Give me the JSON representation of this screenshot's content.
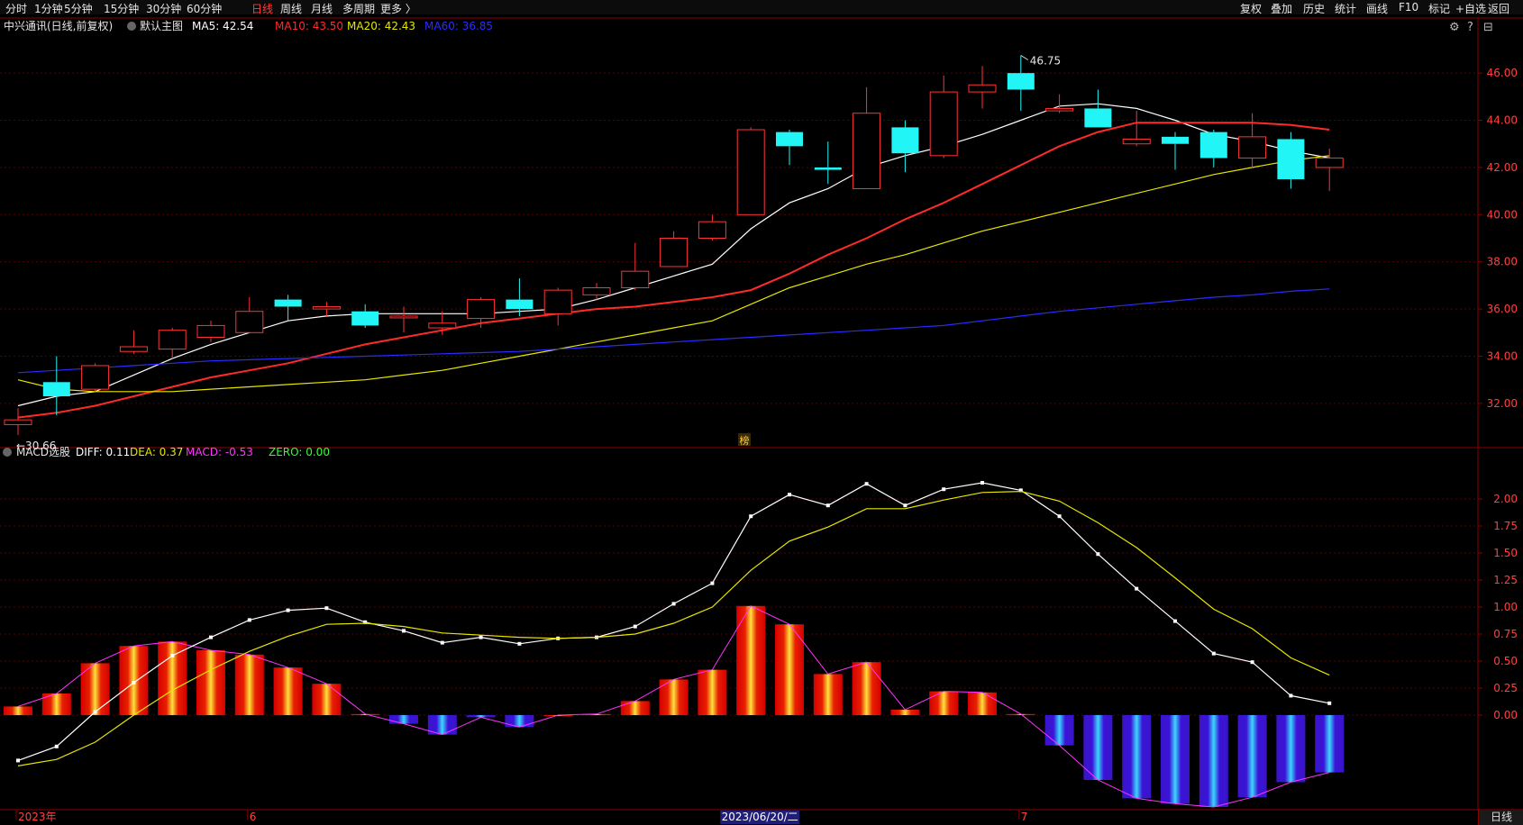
{
  "toolbar": {
    "left_items": [
      {
        "label": "分时",
        "active": false
      },
      {
        "label": "1分钟",
        "active": false
      },
      {
        "label": "5分钟",
        "active": false
      },
      {
        "label": "15分钟",
        "active": false
      },
      {
        "label": "30分钟",
        "active": false
      },
      {
        "label": "60分钟",
        "active": false
      },
      {
        "label": "日线",
        "active": true
      },
      {
        "label": "周线",
        "active": false
      },
      {
        "label": "月线",
        "active": false
      },
      {
        "label": "多周期",
        "active": false
      },
      {
        "label": "更多 〉",
        "active": false
      }
    ],
    "right_items": [
      "复权",
      "叠加",
      "历史",
      "统计",
      "画线",
      "F10",
      "标记",
      "+自选",
      "返回"
    ]
  },
  "main_panel": {
    "title": "中兴通讯(日线,前复权)",
    "indicator_name": "默认主图",
    "legend": [
      {
        "text": "MA5: 42.54",
        "color": "#ffffff"
      },
      {
        "text": "MA10: 43.50",
        "color": "#ff2a2a"
      },
      {
        "text": "MA20: 42.43",
        "color": "#e6e600"
      },
      {
        "text": "MA60: 36.85",
        "color": "#2b2bff"
      }
    ],
    "high_label": "46.75",
    "low_label": "←30.66",
    "marker_label": "榜",
    "panel_icons": [
      "⚙",
      "?",
      "⊟"
    ]
  },
  "macd_panel": {
    "title": "MACD选股",
    "legend": [
      {
        "text": "DIFF: 0.11",
        "color": "#ffffff"
      },
      {
        "text": "DEA: 0.37",
        "color": "#e6e600"
      },
      {
        "text": "MACD: -0.53",
        "color": "#ff33ff"
      },
      {
        "text": "ZERO: 0.00",
        "color": "#33ff33"
      }
    ]
  },
  "time_axis": {
    "labels": [
      {
        "text": "2023年",
        "idx": 0
      },
      {
        "text": "6",
        "idx": 6
      },
      {
        "text": "7",
        "idx": 26
      }
    ],
    "highlight": {
      "text": "2023/06/20/二",
      "idx": 19
    },
    "period": "日线"
  },
  "chart_data": [
    {
      "type": "candlestick",
      "title": "中兴通讯(日线,前复权)",
      "ylim": [
        30.2,
        47.8
      ],
      "y_ticks": [
        "32.00",
        "34.00",
        "36.00",
        "38.00",
        "40.00",
        "42.00",
        "44.00",
        "46.00"
      ],
      "candles": [
        {
          "o": 31.1,
          "h": 31.8,
          "l": 30.66,
          "c": 31.3
        },
        {
          "o": 32.9,
          "h": 34.0,
          "l": 31.5,
          "c": 32.3
        },
        {
          "o": 32.6,
          "h": 33.7,
          "l": 32.5,
          "c": 33.6
        },
        {
          "o": 34.2,
          "h": 35.1,
          "l": 34.1,
          "c": 34.4
        },
        {
          "o": 34.3,
          "h": 35.2,
          "l": 33.9,
          "c": 35.1
        },
        {
          "o": 34.8,
          "h": 35.5,
          "l": 34.6,
          "c": 35.3
        },
        {
          "o": 35.0,
          "h": 36.5,
          "l": 35.0,
          "c": 35.9
        },
        {
          "o": 36.4,
          "h": 36.6,
          "l": 35.5,
          "c": 36.1
        },
        {
          "o": 36.0,
          "h": 36.3,
          "l": 35.7,
          "c": 36.1
        },
        {
          "o": 35.9,
          "h": 36.2,
          "l": 35.2,
          "c": 35.3
        },
        {
          "o": 35.7,
          "h": 36.1,
          "l": 35.0,
          "c": 35.7
        },
        {
          "o": 35.2,
          "h": 35.9,
          "l": 34.9,
          "c": 35.4
        },
        {
          "o": 35.6,
          "h": 36.5,
          "l": 35.2,
          "c": 36.4
        },
        {
          "o": 36.4,
          "h": 37.3,
          "l": 35.7,
          "c": 36.0
        },
        {
          "o": 35.8,
          "h": 36.9,
          "l": 35.3,
          "c": 36.8
        },
        {
          "o": 36.6,
          "h": 37.1,
          "l": 36.4,
          "c": 36.9
        },
        {
          "o": 36.9,
          "h": 38.8,
          "l": 36.8,
          "c": 37.6
        },
        {
          "o": 37.8,
          "h": 39.3,
          "l": 37.8,
          "c": 39.0
        },
        {
          "o": 39.0,
          "h": 40.0,
          "l": 38.9,
          "c": 39.7
        },
        {
          "o": 40.0,
          "h": 43.7,
          "l": 40.0,
          "c": 43.6
        },
        {
          "o": 43.5,
          "h": 43.6,
          "l": 42.1,
          "c": 42.9
        },
        {
          "o": 42.0,
          "h": 43.1,
          "l": 41.3,
          "c": 41.9
        },
        {
          "o": 41.1,
          "h": 45.4,
          "l": 41.1,
          "c": 44.3
        },
        {
          "o": 43.7,
          "h": 44.0,
          "l": 41.8,
          "c": 42.6
        },
        {
          "o": 42.5,
          "h": 45.9,
          "l": 42.4,
          "c": 45.2
        },
        {
          "o": 45.2,
          "h": 46.3,
          "l": 44.5,
          "c": 45.5
        },
        {
          "o": 46.0,
          "h": 46.75,
          "l": 44.4,
          "c": 45.3
        },
        {
          "o": 44.4,
          "h": 45.1,
          "l": 44.3,
          "c": 44.5
        },
        {
          "o": 44.5,
          "h": 45.3,
          "l": 43.7,
          "c": 43.7
        },
        {
          "o": 43.0,
          "h": 44.4,
          "l": 42.9,
          "c": 43.2
        },
        {
          "o": 43.3,
          "h": 43.5,
          "l": 41.9,
          "c": 43.0
        },
        {
          "o": 43.5,
          "h": 43.6,
          "l": 42.0,
          "c": 42.4
        },
        {
          "o": 42.4,
          "h": 44.3,
          "l": 42.0,
          "c": 43.3
        },
        {
          "o": 43.2,
          "h": 43.5,
          "l": 41.1,
          "c": 41.5
        },
        {
          "o": 42.0,
          "h": 42.8,
          "l": 41.0,
          "c": 42.4
        }
      ],
      "series": [
        {
          "name": "MA5",
          "color": "#ffffff",
          "values": [
            31.9,
            32.3,
            32.5,
            33.2,
            33.9,
            34.5,
            35.0,
            35.5,
            35.7,
            35.8,
            35.8,
            35.8,
            35.8,
            35.9,
            36.0,
            36.4,
            36.9,
            37.4,
            37.9,
            39.4,
            40.5,
            41.1,
            42.0,
            42.5,
            42.9,
            43.4,
            44.0,
            44.6,
            44.7,
            44.5,
            44.0,
            43.4,
            43.1,
            42.7,
            42.4
          ]
        },
        {
          "name": "MA10",
          "color": "#ff2a2a",
          "values": [
            31.4,
            31.6,
            31.9,
            32.3,
            32.7,
            33.1,
            33.4,
            33.7,
            34.1,
            34.5,
            34.8,
            35.1,
            35.4,
            35.6,
            35.8,
            36.0,
            36.1,
            36.3,
            36.5,
            36.8,
            37.5,
            38.3,
            39.0,
            39.8,
            40.5,
            41.3,
            42.1,
            42.9,
            43.5,
            43.9,
            43.9,
            43.9,
            43.9,
            43.8,
            43.6
          ]
        },
        {
          "name": "MA20",
          "color": "#e6e600",
          "values": [
            33.0,
            32.6,
            32.5,
            32.5,
            32.5,
            32.6,
            32.7,
            32.8,
            32.9,
            33.0,
            33.2,
            33.4,
            33.7,
            34.0,
            34.3,
            34.6,
            34.9,
            35.2,
            35.5,
            36.2,
            36.9,
            37.4,
            37.9,
            38.3,
            38.8,
            39.3,
            39.7,
            40.1,
            40.5,
            40.9,
            41.3,
            41.7,
            42.0,
            42.3,
            42.5
          ]
        },
        {
          "name": "MA60",
          "color": "#2b2bff",
          "values": [
            33.3,
            33.4,
            33.5,
            33.6,
            33.7,
            33.8,
            33.85,
            33.9,
            33.95,
            34.0,
            34.05,
            34.1,
            34.15,
            34.2,
            34.3,
            34.4,
            34.5,
            34.6,
            34.7,
            34.8,
            34.9,
            35.0,
            35.1,
            35.2,
            35.3,
            35.5,
            35.7,
            35.9,
            36.05,
            36.2,
            36.35,
            36.5,
            36.6,
            36.75,
            36.85
          ]
        }
      ]
    },
    {
      "type": "bar",
      "title": "MACD",
      "ylim": [
        -0.85,
        2.45
      ],
      "y_ticks": [
        "0.00",
        "0.25",
        "0.50",
        "0.75",
        "1.00",
        "1.25",
        "1.50",
        "1.75",
        "2.00"
      ],
      "macd": [
        0.08,
        0.2,
        0.48,
        0.64,
        0.68,
        0.6,
        0.56,
        0.44,
        0.29,
        0.01,
        -0.08,
        -0.18,
        -0.02,
        -0.11,
        0.0,
        0.01,
        0.13,
        0.33,
        0.42,
        1.01,
        0.84,
        0.38,
        0.49,
        0.05,
        0.22,
        0.21,
        0.01,
        -0.28,
        -0.6,
        -0.77,
        -0.82,
        -0.85,
        -0.76,
        -0.62,
        -0.53
      ],
      "series": [
        {
          "name": "DIFF",
          "color": "#ffffff",
          "values": [
            -0.42,
            -0.29,
            0.03,
            0.3,
            0.55,
            0.72,
            0.88,
            0.97,
            0.99,
            0.86,
            0.78,
            0.67,
            0.72,
            0.66,
            0.71,
            0.72,
            0.82,
            1.03,
            1.22,
            1.84,
            2.04,
            1.94,
            2.14,
            1.94,
            2.09,
            2.15,
            2.08,
            1.84,
            1.49,
            1.17,
            0.87,
            0.57,
            0.49,
            0.18,
            0.11
          ]
        },
        {
          "name": "DEA",
          "color": "#e6e600",
          "values": [
            -0.47,
            -0.41,
            -0.25,
            0.0,
            0.23,
            0.42,
            0.59,
            0.73,
            0.84,
            0.85,
            0.82,
            0.76,
            0.74,
            0.72,
            0.71,
            0.72,
            0.75,
            0.85,
            1.0,
            1.34,
            1.61,
            1.74,
            1.91,
            1.91,
            1.99,
            2.06,
            2.07,
            1.98,
            1.78,
            1.55,
            1.27,
            0.98,
            0.8,
            0.53,
            0.37
          ]
        }
      ]
    }
  ]
}
